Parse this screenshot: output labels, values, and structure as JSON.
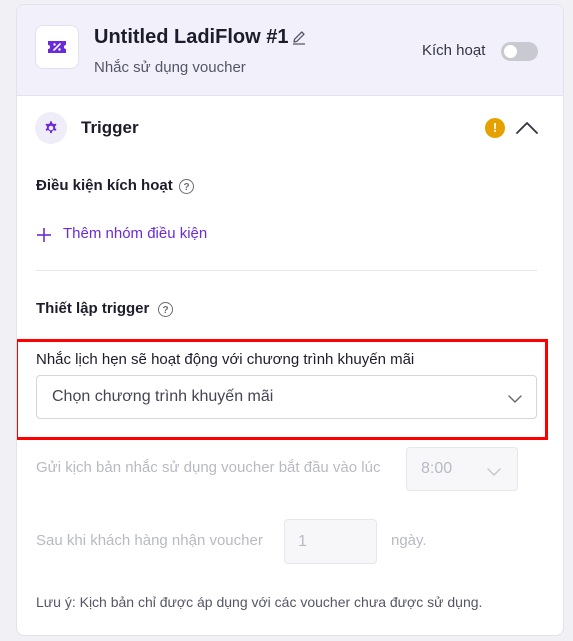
{
  "header": {
    "title": "Untitled LadiFlow #1",
    "subtitle": "Nhắc sử dụng voucher",
    "toggle_label": "Kích hoạt",
    "toggle_on": false,
    "app_icon": "ticket-percent-icon",
    "edit_icon": "pencil-icon"
  },
  "trigger": {
    "title": "Trigger",
    "icon": "gear-icon",
    "warning": "!",
    "collapse_icon": "chevron-up-icon",
    "conditions_label": "Điều kiện kích hoạt",
    "add_group_label": "Thêm nhóm điều kiện",
    "setup_label": "Thiết lập trigger",
    "help_glyph": "?"
  },
  "promotion": {
    "label": "Nhắc lịch hẹn sẽ hoạt động với chương trình khuyến mãi",
    "placeholder": "Chọn chương trình khuyến mãi"
  },
  "schedule": {
    "start_label": "Gửi kịch bản nhắc sử dụng voucher bắt đầu vào lúc",
    "start_time": "8:00",
    "after_label": "Sau khi khách hàng nhận voucher",
    "days_value": "1",
    "days_unit": "ngày."
  },
  "note": "Lưu ý: Kịch bản chỉ được áp dụng với các voucher chưa được sử dụng.",
  "colors": {
    "accent": "#6a2bd9",
    "warning": "#e6a100",
    "highlight": "#ff0000",
    "header_bg": "#f2f0fb"
  }
}
